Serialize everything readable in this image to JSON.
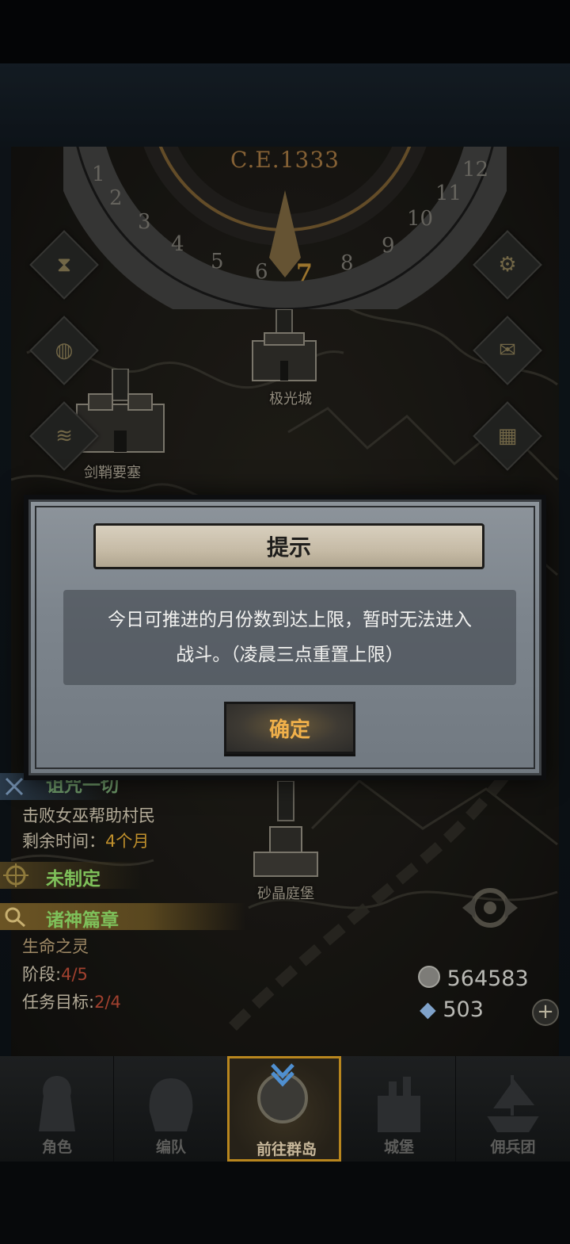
{
  "calendar": {
    "year": "C.E.1333",
    "months": [
      "1",
      "2",
      "3",
      "4",
      "5",
      "6",
      "7",
      "8",
      "9",
      "10",
      "11",
      "12"
    ],
    "current_month": "7"
  },
  "map": {
    "locations": [
      {
        "name": "极光城"
      },
      {
        "name": "剑鞘要塞"
      },
      {
        "name": "砂晶庭堡"
      }
    ]
  },
  "side_buttons": {
    "left": [
      "hourglass-icon",
      "bag-icon",
      "scroll-icon"
    ],
    "right": [
      "gear-icon",
      "mail-icon",
      "grid-icon"
    ]
  },
  "dialog": {
    "title": "提示",
    "message_line1": "今日可推进的月份数到达上限，暂时无法进入",
    "message_line2": "战斗。（凌晨三点重置上限）",
    "confirm_label": "确定"
  },
  "quests": {
    "main_title": "诅咒一切",
    "main_desc": "击败女巫帮助村民",
    "time_label": "剩余时间：",
    "time_value": "4个月",
    "unset_label": "未制定",
    "chapter_title": "诸神篇章",
    "chapter_name": "生命之灵",
    "stage_label": "阶段:",
    "stage_value": "4/5",
    "goal_label": "任务目标:",
    "goal_value": "2/4"
  },
  "resources": {
    "silver": "564583",
    "crystal": "503",
    "add_label": "+"
  },
  "nav": {
    "items": [
      {
        "label": "角色"
      },
      {
        "label": "编队"
      },
      {
        "label": "前往群岛"
      },
      {
        "label": "城堡"
      },
      {
        "label": "佣兵团"
      }
    ],
    "active_index": 2
  },
  "colors": {
    "accent_gold": "#d7a13f",
    "confirm_text": "#f0b04a",
    "quest_green": "#7ec05a",
    "nav_active_border": "#b8861e"
  }
}
